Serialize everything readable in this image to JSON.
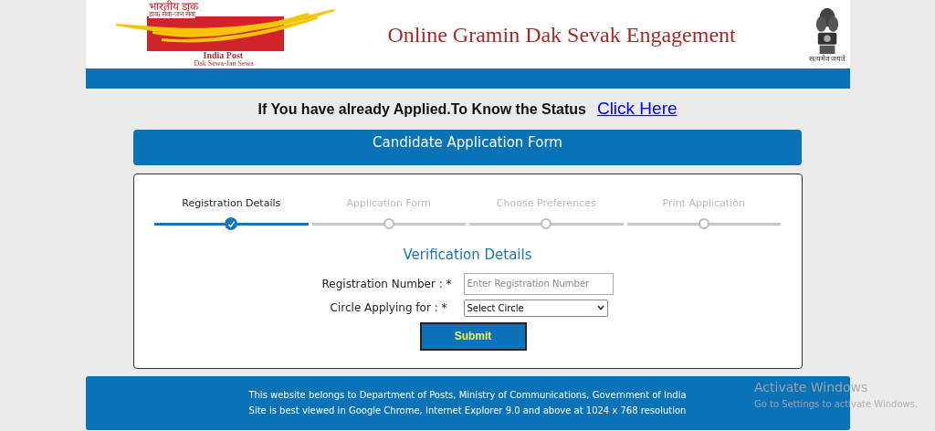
{
  "header": {
    "logo": {
      "hindi_title": "भारतीय डाक",
      "hindi_tagline": "डाक सेवा-जन सेवा",
      "name": "India Post",
      "tagline": "Dak Sewa-Jan Sewa"
    },
    "title": "Online Gramin Dak Sevak Engagement",
    "emblem_motto": "सत्यमेव जयते"
  },
  "status_prompt": {
    "text": "If You have already Applied.To Know the Status",
    "link": "Click Here"
  },
  "form_banner": "Candidate Application Form",
  "steps": [
    {
      "label": "Registration Details",
      "selected": true
    },
    {
      "label": "Application Form",
      "selected": false
    },
    {
      "label": "Choose Preferences",
      "selected": false
    },
    {
      "label": "Print Application",
      "selected": false
    }
  ],
  "section_title": "Verification Details",
  "fields": [
    {
      "kind": "text",
      "label": "Registration Number : *",
      "placeholder": "Enter Registration Number"
    },
    {
      "kind": "select",
      "label": "Circle Applying for : *",
      "value": "Select Circle"
    }
  ],
  "submit": "Submit",
  "footer": [
    "This website belongs to Department of Posts, Ministry of Communications, Government of India",
    "Site is best viewed in Google Chrome, Internet Explorer 9.0 and above at 1024 x 768 resolution"
  ],
  "os_notice": {
    "title": "Activate Windows",
    "subtitle": "Go to Settings to activate Windows."
  }
}
